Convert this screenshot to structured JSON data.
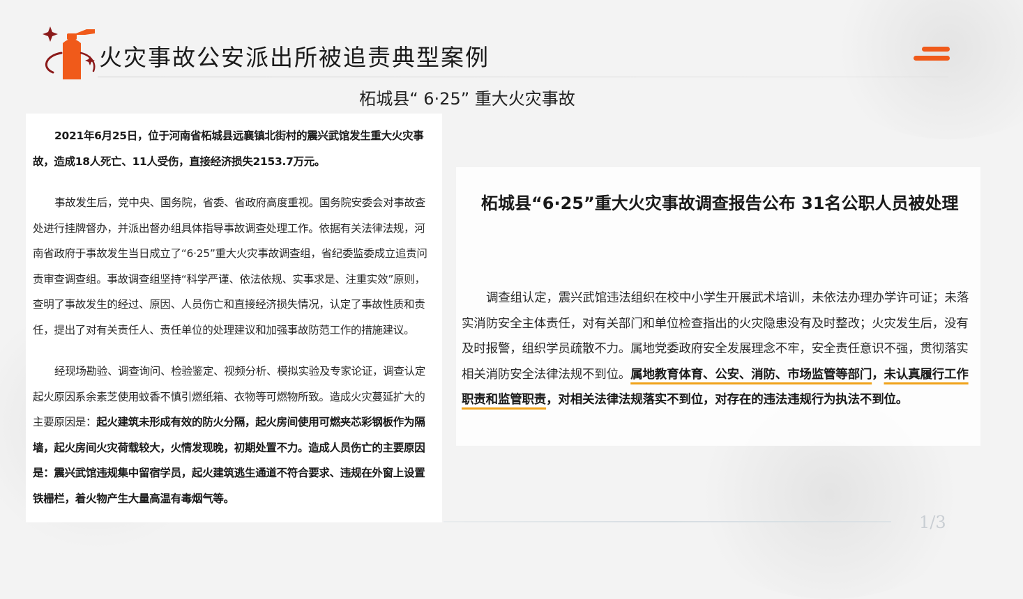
{
  "header": {
    "title": "火灾事故公安派出所被追责典型案例",
    "logo_icon": "fire-extinguisher-icon",
    "menu_icon": "menu-icon",
    "accent_color": "#f05a1a"
  },
  "subtitle": "柘城县“ 6·25” 重大火灾事故",
  "left_panel": {
    "p1": "2021年6月25日，位于河南省柘城县远襄镇北街村的震兴武馆发生重大火灾事故，造成18人死亡、11人受伤，直接经济损失2153.7万元。",
    "p2": "事故发生后，党中央、国务院，省委、省政府高度重视。国务院安委会对事故查处进行挂牌督办，并派出督办组具体指导事故调查处理工作。依据有关法律法规，河南省政府于事故发生当日成立了“6·25”重大火灾事故调查组，省纪委监委成立追责问责审查调查组。事故调查组坚持“科学严谨、依法依规、实事求是、注重实效”原则，查明了事故发生的经过、原因、人员伤亡和直接经济损失情况，认定了事故性质和责任，提出了对有关责任人、责任单位的处理建议和加强事故防范工作的措施建议。",
    "p3_normal": "经现场勘验、调查询问、检验鉴定、视频分析、模拟实验及专家论证，调查认定起火原因系余素芝使用蚊香不慎引燃纸箱、衣物等可燃物所致。造成火灾蔓延扩大的主要原因是：",
    "p3_bold": "起火建筑未形成有效的防火分隔，起火房间使用可燃夹芯彩钢板作为隔墙，起火房间火灾荷载较大，火情发现晚，初期处置不力。造成人员伤亡的主要原因是：震兴武馆违规集中留宿学员，起火建筑逃生通道不符合要求、违规在外窗上设置铁栅栏，着火物产生大量高温有毒烟气等。"
  },
  "right_panel": {
    "title": "柘城县“6·25”重大火灾事故调查报告公布 31名公职人员被处理",
    "body_normal": "调查组认定，震兴武馆违法组织在校中小学生开展武术培训，未依法办理办学许可证；未落实消防安全主体责任，对有关部门和单位检查指出的火灾隐患没有及时整改；火灾发生后，没有及时报警，组织学员疏散不力。属地党委政府安全发展理念不牢，安全责任意识不强，贯彻落实相关消防安全法律法规不到位。",
    "body_hl1": "属地教育体育、公安、消防、市场监管等部门",
    "body_mid": "，",
    "body_hl2": "未认真履行工作职责和监管职责",
    "body_end": "，对相关法律法规落实不到位，对存在的违法违规行为执法不到位。"
  },
  "footer": {
    "page": "1/3"
  }
}
